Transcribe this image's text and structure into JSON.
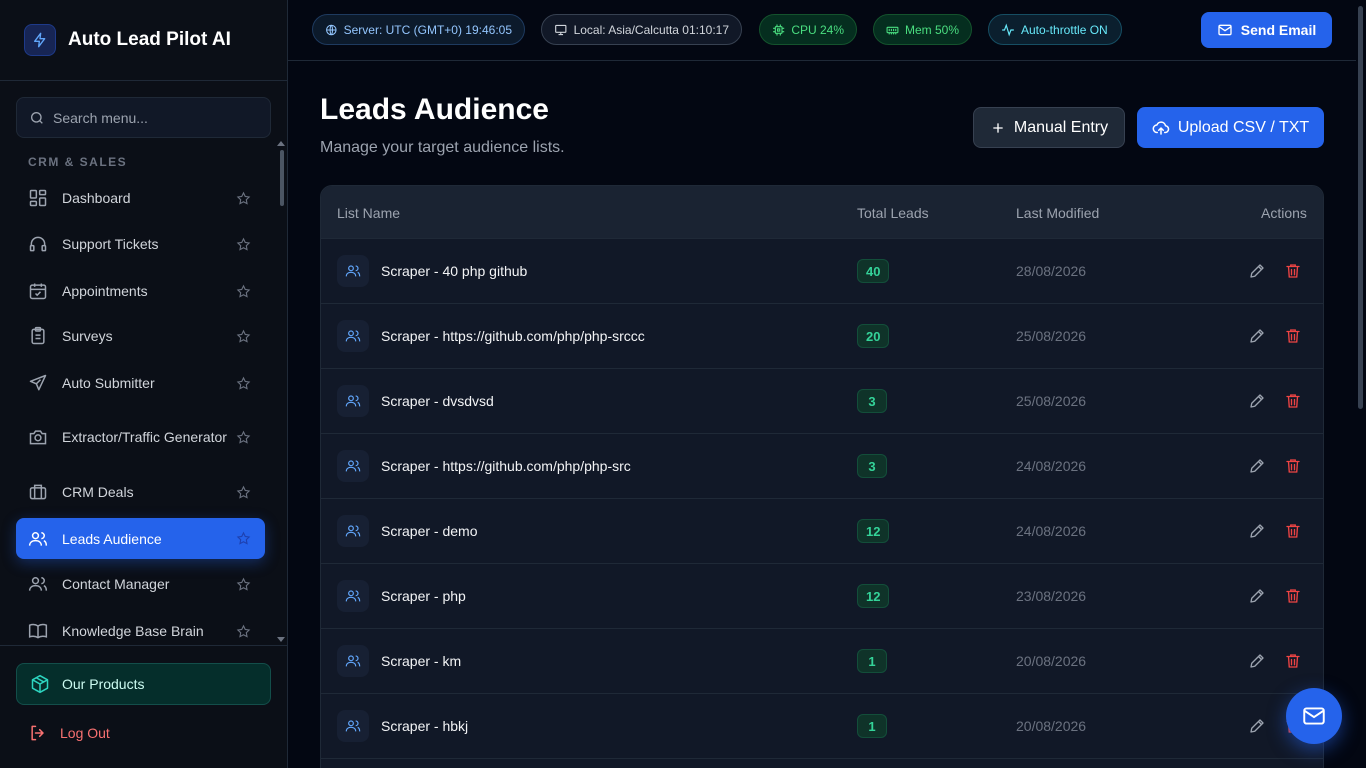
{
  "app": {
    "name": "Auto Lead Pilot AI"
  },
  "sidebar": {
    "search_placeholder": "Search menu...",
    "section": "CRM & SALES",
    "items": [
      {
        "label": "Dashboard",
        "icon": "dashboard-icon"
      },
      {
        "label": "Support Tickets",
        "icon": "headset-icon"
      },
      {
        "label": "Appointments",
        "icon": "calendar-check-icon"
      },
      {
        "label": "Surveys",
        "icon": "clipboard-icon"
      },
      {
        "label": "Auto Submitter",
        "icon": "send-icon"
      },
      {
        "label": "Extractor/Traffic Generator",
        "icon": "camera-icon"
      },
      {
        "label": "CRM Deals",
        "icon": "briefcase-icon"
      },
      {
        "label": "Leads Audience",
        "icon": "users-icon",
        "active": true
      },
      {
        "label": "Contact Manager",
        "icon": "users-icon"
      },
      {
        "label": "Knowledge Base Brain",
        "icon": "book-icon"
      }
    ],
    "products_label": "Our Products",
    "logout_label": "Log Out"
  },
  "topbar": {
    "server": "Server: UTC (GMT+0) 19:46:05",
    "local": "Local: Asia/Calcutta 01:10:17",
    "cpu": "CPU 24%",
    "mem": "Mem 50%",
    "throttle": "Auto-throttle ON",
    "send_email": "Send Email"
  },
  "page": {
    "title": "Leads Audience",
    "subtitle": "Manage your target audience lists.",
    "manual_entry": "Manual Entry",
    "upload": "Upload CSV / TXT"
  },
  "table": {
    "headers": {
      "name": "List Name",
      "total": "Total Leads",
      "modified": "Last Modified",
      "actions": "Actions"
    },
    "rows": [
      {
        "name": "Scraper - 40 php github",
        "total": "40",
        "modified": "28/08/2026"
      },
      {
        "name": "Scraper - https://github.com/php/php-srccc",
        "total": "20",
        "modified": "25/08/2026"
      },
      {
        "name": "Scraper - dvsdvsd",
        "total": "3",
        "modified": "25/08/2026"
      },
      {
        "name": "Scraper - https://github.com/php/php-src",
        "total": "3",
        "modified": "24/08/2026"
      },
      {
        "name": "Scraper - demo",
        "total": "12",
        "modified": "24/08/2026"
      },
      {
        "name": "Scraper - php",
        "total": "12",
        "modified": "23/08/2026"
      },
      {
        "name": "Scraper - km",
        "total": "1",
        "modified": "20/08/2026"
      },
      {
        "name": "Scraper - hbkj",
        "total": "1",
        "modified": "20/08/2026"
      }
    ]
  },
  "colors": {
    "accent": "#2563eb",
    "danger": "#ef4444",
    "success": "#34d399"
  }
}
